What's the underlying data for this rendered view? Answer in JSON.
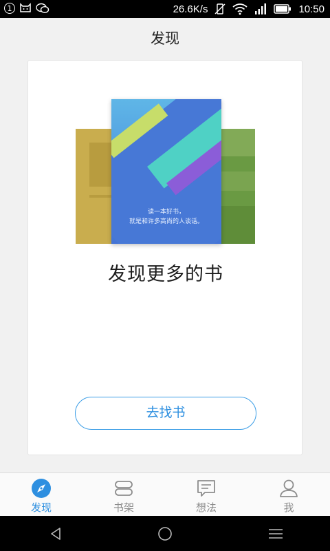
{
  "status_bar": {
    "notification_count": "1",
    "network_speed": "26.6K/s",
    "time": "10:50",
    "icons": [
      "notification-badge-icon",
      "cat-icon",
      "wechat-icon",
      "vibrate-off-icon",
      "wifi-icon",
      "signal-icon",
      "battery-icon"
    ]
  },
  "header": {
    "title": "发现"
  },
  "card": {
    "cover_line1": "读一本好书，",
    "cover_line2": "就是和许多高尚的人谈话。",
    "headline": "发现更多的书",
    "button_label": "去找书"
  },
  "tabs": [
    {
      "label": "发现",
      "icon": "compass-icon",
      "active": true
    },
    {
      "label": "书架",
      "icon": "bookshelf-icon",
      "active": false
    },
    {
      "label": "想法",
      "icon": "comment-icon",
      "active": false
    },
    {
      "label": "我",
      "icon": "person-icon",
      "active": false
    }
  ],
  "nav_bar": {
    "icons": [
      "back-icon",
      "home-icon",
      "menu-icon"
    ]
  },
  "colors": {
    "accent": "#2e8fe0",
    "inactive": "#8c8c8c"
  }
}
